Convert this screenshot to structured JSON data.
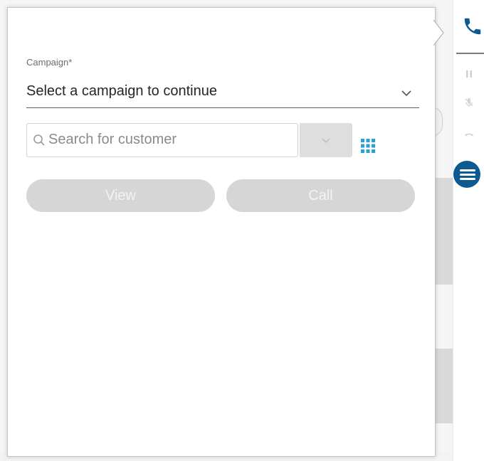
{
  "campaign": {
    "label": "Campaign*",
    "placeholder": "Select a campaign to continue"
  },
  "search": {
    "placeholder": "Search for customer",
    "value": ""
  },
  "actions": {
    "view_label": "View",
    "call_label": "Call"
  },
  "rail": {
    "icons": [
      "phone-icon",
      "pause-icon",
      "mute-icon",
      "hangup-icon",
      "menu-icon"
    ]
  },
  "colors": {
    "accent": "#0c5a8f",
    "grid_icon": "#2a9fd6",
    "disabled_button": "#d6d6d6"
  }
}
